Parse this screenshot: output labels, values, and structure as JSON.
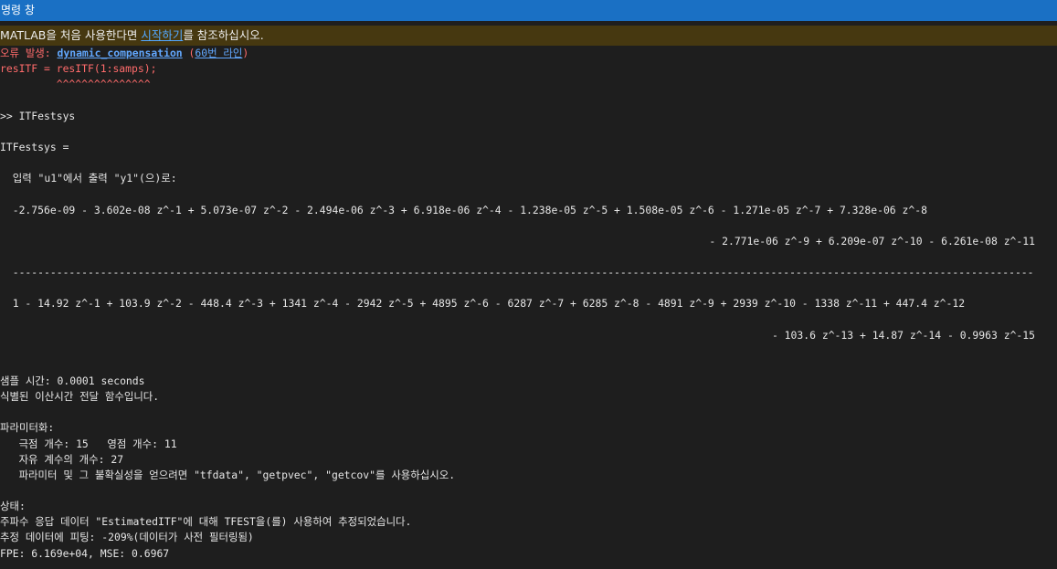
{
  "titlebar": {
    "title": "명령 창"
  },
  "infobar": {
    "prefix": "MATLAB을 처음 사용한다면 ",
    "link": "시작하기",
    "suffix": "를 참조하십시오."
  },
  "console": {
    "error_prefix": "오류 발생: ",
    "error_function": "dynamic_compensation",
    "error_paren_open": " (",
    "error_line_link": "60번 라인",
    "error_paren_close": ")",
    "error_code": "resITF = resITF(1:samps);",
    "error_carets": "         ^^^^^^^^^^^^^^^",
    "prompt_command": ">> ITFestsys",
    "var_name": "ITFestsys =",
    "io_description": "  입력 \"u1\"에서 출력 \"y1\"(으)로:",
    "numerator_line1": "  -2.756e-09 - 3.602e-08 z^-1 + 5.073e-07 z^-2 - 2.494e-06 z^-3 + 6.918e-06 z^-4 - 1.238e-05 z^-5 + 1.508e-05 z^-6 - 1.271e-05 z^-7 + 7.328e-06 z^-8",
    "numerator_line2": "- 2.771e-06 z^-9 + 6.209e-07 z^-10 - 6.261e-08 z^-11",
    "divider": "  -------------------------------------------------------------------------------------------------------------------------------------------------------------------",
    "denominator_line1": "  1 - 14.92 z^-1 + 103.9 z^-2 - 448.4 z^-3 + 1341 z^-4 - 2942 z^-5 + 4895 z^-6 - 6287 z^-7 + 6285 z^-8 - 4891 z^-9 + 2939 z^-10 - 1338 z^-11 + 447.4 z^-12",
    "denominator_line2": "- 103.6 z^-13 + 14.87 z^-14 - 0.9963 z^-15",
    "sample_time": "샘플 시간: 0.0001 seconds",
    "identified": "식별된 이산시간 전달 함수입니다.",
    "param_header": "파라미터화:",
    "poles_zeros": "   극점 개수: 15   영점 개수: 11",
    "free_coeffs": "   자유 계수의 개수: 27",
    "param_hint_prefix": "   파라미터 및 그 불확실성을 얻으려면 ",
    "param_hint_tfdata": "\"tfdata\"",
    "param_hint_sep1": ", ",
    "param_hint_getpvec": "\"getpvec\"",
    "param_hint_sep2": ", ",
    "param_hint_getcov": "\"getcov\"",
    "param_hint_suffix": "를 사용하십시오.",
    "status_header": "상태:",
    "status_line1": "주파수 응답 데이터 \"EstimatedITF\"에 대해 TFEST을(를) 사용하여 추정되었습니다.",
    "status_line2": "추정 데이터에 피팅: -209%(데이터가 사전 필터링됨)",
    "status_line3": "FPE: 6.169e+04, MSE: 0.6967"
  }
}
